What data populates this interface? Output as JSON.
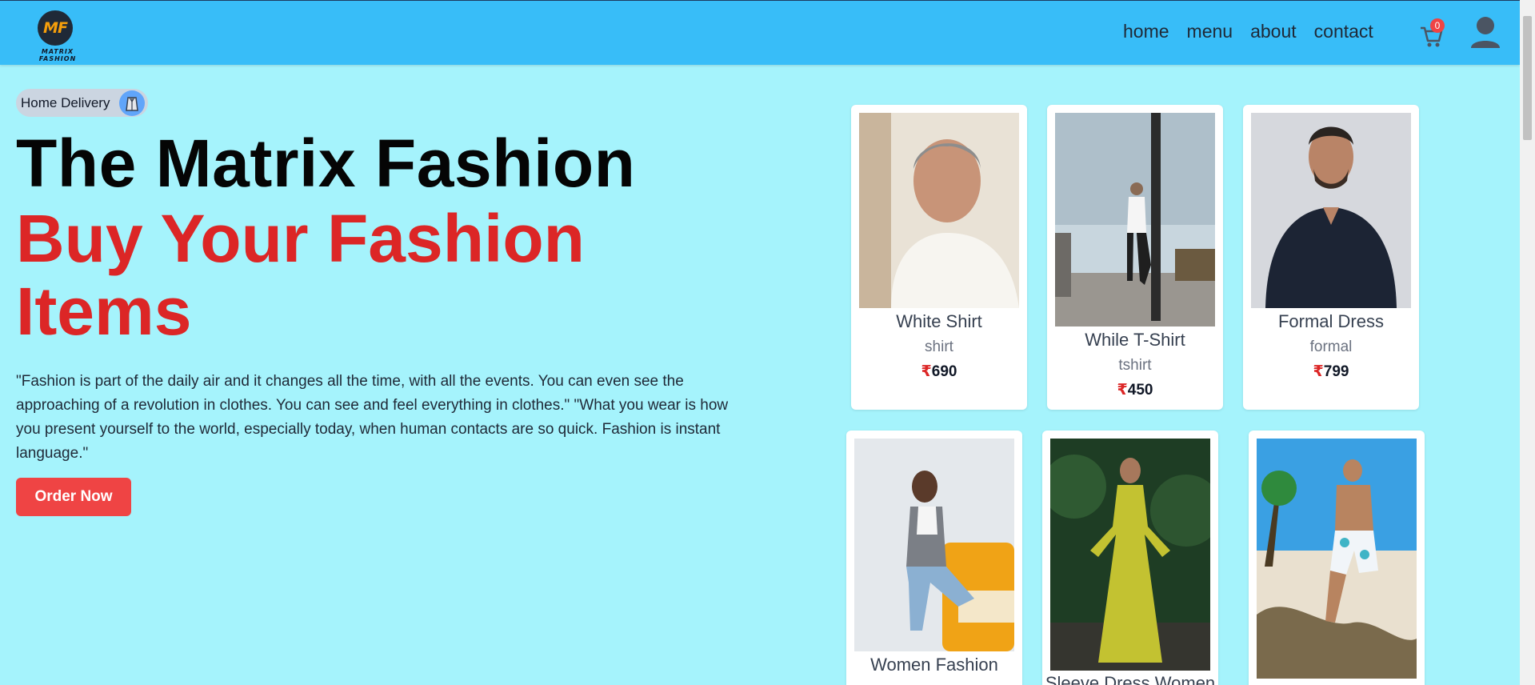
{
  "brand": {
    "logo_mark": "MF",
    "logo_text": "MATRIX FASHION"
  },
  "nav": {
    "links": [
      "home",
      "menu",
      "about",
      "contact"
    ],
    "cart_count": "0"
  },
  "hero": {
    "badge": "Home Delivery",
    "title_line1": "The Matrix Fashion",
    "title_line2": "Buy Your Fashion Items",
    "quote": "\"Fashion is part of the daily air and it changes all the time, with all the events. You can even see the approaching of a revolution in clothes. You can see and feel everything in clothes.\" \"What you wear is how you present yourself to the world, especially today, when human contacts are so quick. Fashion is instant language.\"",
    "cta": "Order Now"
  },
  "products": [
    {
      "name": "White Shirt",
      "category": "shirt",
      "currency": "₹",
      "price": "690"
    },
    {
      "name": "While T-Shirt",
      "category": "tshirt",
      "currency": "₹",
      "price": "450"
    },
    {
      "name": "Formal Dress",
      "category": "formal",
      "currency": "₹",
      "price": "799"
    },
    {
      "name": "Women Fashion"
    },
    {
      "name": "Sleeve Dress Women"
    },
    {
      "name": ""
    }
  ],
  "colors": {
    "nav": "#38bdf8",
    "background": "#a5f3fc",
    "accent": "#dc2626",
    "button": "#ef4444"
  }
}
